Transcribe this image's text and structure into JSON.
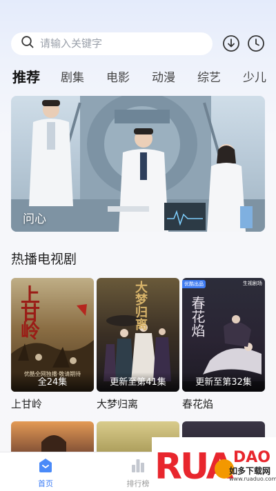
{
  "search": {
    "placeholder": "请输入关键字"
  },
  "header_icons": [
    "download-icon",
    "history-clock-icon"
  ],
  "tabs": [
    {
      "label": "推荐",
      "active": true
    },
    {
      "label": "剧集"
    },
    {
      "label": "电影"
    },
    {
      "label": "动漫"
    },
    {
      "label": "综艺"
    },
    {
      "label": "少儿"
    }
  ],
  "banner": {
    "title": "问心"
  },
  "section": {
    "title": "热播电视剧"
  },
  "dramas": [
    {
      "title": "上甘岭",
      "caption": "全24集",
      "poster_text": "上甘岭",
      "badge_text": "优酷全网独播·敬请期待"
    },
    {
      "title": "大梦归离",
      "caption": "更新至第41集",
      "poster_text": "大梦归离"
    },
    {
      "title": "春花焰",
      "caption": "更新至第32集",
      "poster_text": "春花焰",
      "badge_text": "优酷出品",
      "corner_text": "生视剧场"
    }
  ],
  "bottom_nav": [
    {
      "label": "首页",
      "icon": "home-icon",
      "active": true
    },
    {
      "label": "排行榜",
      "icon": "ranking-icon",
      "active": false
    }
  ],
  "watermark": {
    "logo_text": "RUANDAO",
    "sub_text": "如多下载网",
    "url": "www.ruaduo.com"
  },
  "colors": {
    "accent": "#3b7cf5",
    "tab_active": "#111111",
    "watermark_red": "#e8262d"
  }
}
